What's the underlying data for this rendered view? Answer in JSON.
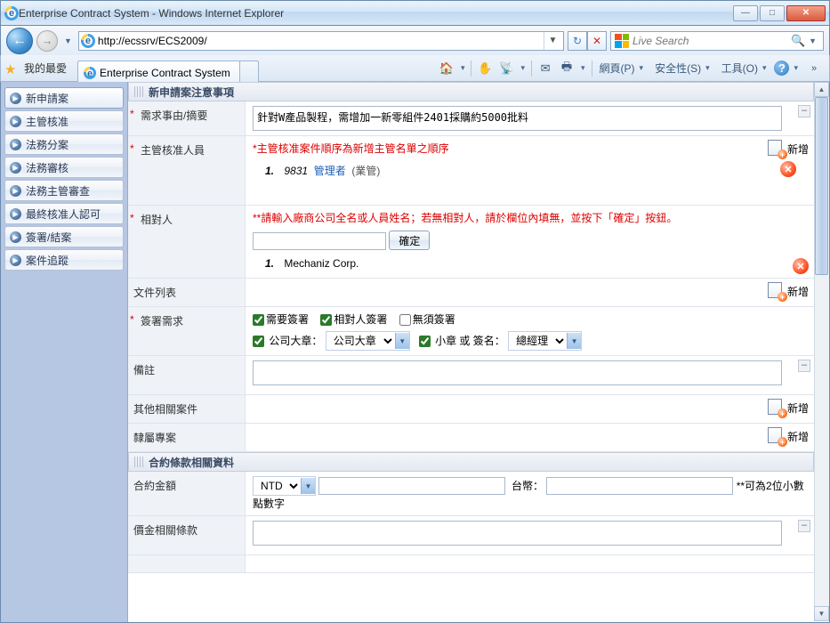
{
  "window": {
    "title": "Enterprise Contract System - Windows Internet Explorer"
  },
  "addressbar": {
    "url": "http://ecssrv/ECS2009/"
  },
  "search": {
    "placeholder": "Live Search"
  },
  "favorites_label": "我的最愛",
  "tab": {
    "title": "Enterprise Contract System"
  },
  "cmdmenu": {
    "page": "網頁(P)",
    "safety": "安全性(S)",
    "tools": "工具(O)"
  },
  "sidebar": {
    "items": [
      {
        "label": "新申請案"
      },
      {
        "label": "主管核准"
      },
      {
        "label": "法務分案"
      },
      {
        "label": "法務審核"
      },
      {
        "label": "法務主管審查"
      },
      {
        "label": "最終核准人認可"
      },
      {
        "label": "簽署/結案"
      },
      {
        "label": "案件追蹤"
      }
    ]
  },
  "section1": {
    "title": "新申請案注意事項"
  },
  "form": {
    "summary_label": "需求事由/摘要",
    "summary_value": "針對W產品製程，需增加一新零組件2401採購約5000批料",
    "approver_label": "主管核准人員",
    "approver_note": "*主管核准案件順序為新增主管名單之順序",
    "approver_item_no": "1.",
    "approver_code": "9831",
    "approver_name": "管理者",
    "approver_role": "(業管)",
    "counter_label": "相對人",
    "counter_note": "**請輸入廠商公司全名或人員姓名；若無相對人，請於欄位內填無，並按下「確定」按鈕。",
    "confirm_btn": "確定",
    "counter_item_no": "1.",
    "counter_name": "Mechaniz Corp.",
    "files_label": "文件列表",
    "sign_label": "簽署需求",
    "sign_need": "需要簽署",
    "sign_counter": "相對人簽署",
    "sign_none": "無須簽署",
    "seal_big_label": "公司大章：",
    "seal_big_value": "公司大章",
    "seal_small_label": "小章 或 簽名：",
    "seal_small_value": "總經理",
    "remark_label": "備註",
    "related_label": "其他相關案件",
    "belong_label": "隸屬專案",
    "add_label": "新增"
  },
  "section2": {
    "title": "合約條款相關資料"
  },
  "contract": {
    "amount_label": "合約金額",
    "currency": "NTD",
    "twd_label": "台幣：",
    "decimal_note": "**可為2位小數點數字",
    "price_terms_label": "價金相關條款"
  }
}
